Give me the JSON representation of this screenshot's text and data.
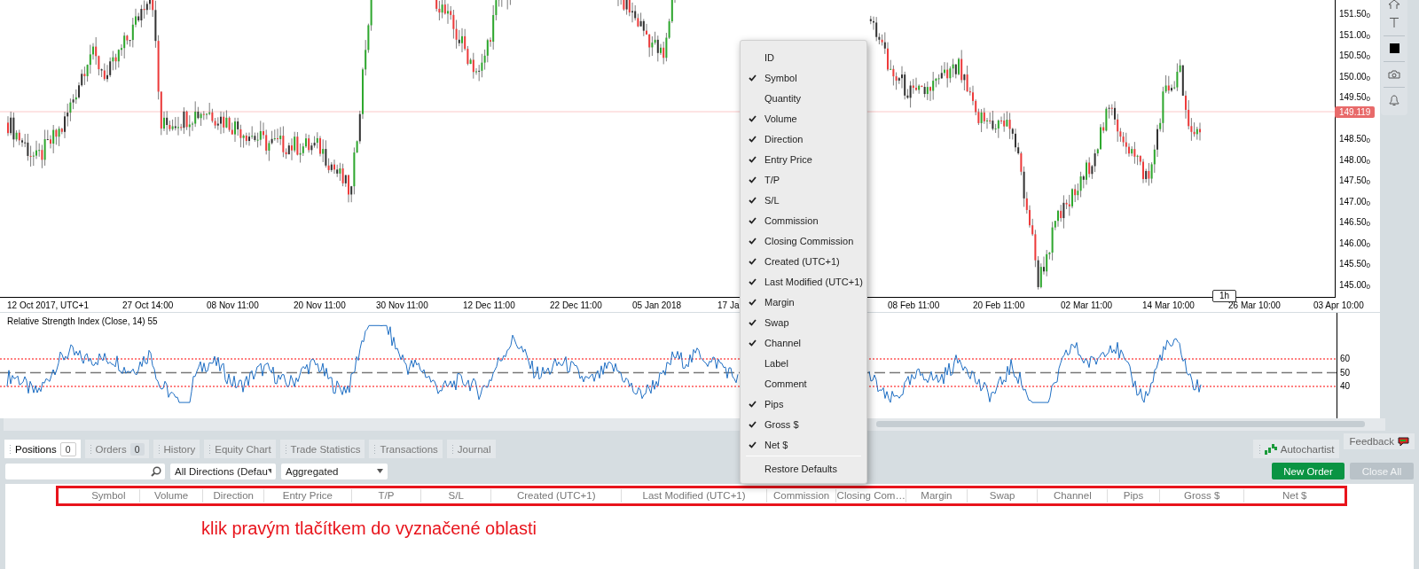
{
  "price_chart": {
    "price_labels": [
      "151.50$_{0}$",
      "151.00$_{0}$",
      "150.50$_{0}$",
      "150.00$_{0}$",
      "149.50$_{0}$",
      "148.50$_{0}$",
      "148.00$_{0}$",
      "147.50$_{0}$",
      "147.00$_{0}$",
      "146.50$_{0}$",
      "146.00$_{0}$",
      "145.50$_{0}$",
      "145.00$_{0}$"
    ],
    "current_price": "149.119",
    "time_labels": [
      "12 Oct 2017, UTC+1",
      "27 Oct 14:00",
      "08 Nov 11:00",
      "20 Nov 11:00",
      "30 Nov 11:00",
      "12 Dec 11:00",
      "22 Dec 11:00",
      "05 Jan 2018",
      "17 Ja",
      "08 Feb 11:00",
      "20 Feb 11:00",
      "02 Mar 11:00",
      "14 Mar 10:00",
      "26 Mar 10:00",
      "03 Apr 10:00"
    ],
    "timeframe": "1h"
  },
  "rsi_panel": {
    "title": "Relative Strength Index (Close, 14) 55",
    "level_labels": [
      "60",
      "50",
      "40"
    ]
  },
  "tabs": [
    {
      "label": "Positions",
      "count": "0",
      "selected": true
    },
    {
      "label": "Orders",
      "count": "0",
      "selected": false
    },
    {
      "label": "History",
      "selected": false
    },
    {
      "label": "Equity Chart",
      "selected": false
    },
    {
      "label": "Trade Statistics",
      "selected": false
    },
    {
      "label": "Transactions",
      "selected": false
    },
    {
      "label": "Journal",
      "selected": false
    }
  ],
  "side_tabs": [
    {
      "label": "Autochartist",
      "kind": "autochartist"
    },
    {
      "label": "Feedback",
      "kind": "feedback"
    }
  ],
  "filters": {
    "direction": "All Directions (Defau",
    "grouping": "Aggregated"
  },
  "buttons": [
    {
      "label": "New Order",
      "disabled": false
    },
    {
      "label": "Close All",
      "disabled": true
    }
  ],
  "table": {
    "columns": [
      "Symbol",
      "Volume",
      "Direction",
      "Entry Price",
      "T/P",
      "S/L",
      "Created (UTC+1)",
      "Last Modified (UTC+1)",
      "Commission",
      "Closing Com…",
      "Margin",
      "Swap",
      "Channel",
      "Pips",
      "Gross $",
      "Net $"
    ]
  },
  "annotation": "klik pravým tlačítkem do vyznačené oblasti",
  "context_menu": {
    "items": [
      {
        "label": "ID",
        "checked": false
      },
      {
        "label": "Symbol",
        "checked": true
      },
      {
        "label": "Quantity",
        "checked": false
      },
      {
        "label": "Volume",
        "checked": true
      },
      {
        "label": "Direction",
        "checked": true
      },
      {
        "label": "Entry Price",
        "checked": true
      },
      {
        "label": "T/P",
        "checked": true
      },
      {
        "label": "S/L",
        "checked": true
      },
      {
        "label": "Commission",
        "checked": true
      },
      {
        "label": "Closing Commission",
        "checked": true
      },
      {
        "label": "Created (UTC+1)",
        "checked": true
      },
      {
        "label": "Last Modified (UTC+1)",
        "checked": true
      },
      {
        "label": "Margin",
        "checked": true
      },
      {
        "label": "Swap",
        "checked": true
      },
      {
        "label": "Channel",
        "checked": true
      },
      {
        "label": "Label",
        "checked": false
      },
      {
        "label": "Comment",
        "checked": false
      },
      {
        "label": "Pips",
        "checked": true
      },
      {
        "label": "Gross $",
        "checked": true
      },
      {
        "label": "Net $",
        "checked": true
      }
    ],
    "footer": "Restore Defaults"
  }
}
